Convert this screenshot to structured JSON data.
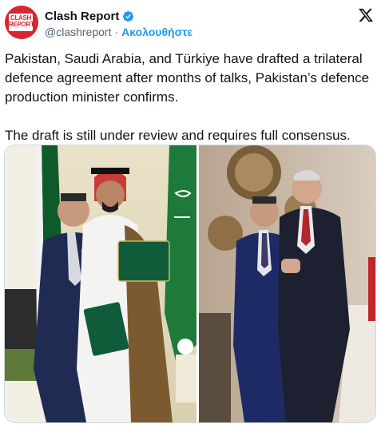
{
  "author": {
    "name": "Clash Report",
    "handle": "@clashreport",
    "separator": "·",
    "follow_label": "Ακολουθήστε",
    "avatar_text_line1": "CLASH",
    "avatar_text_line2": "REPORT"
  },
  "tweet": {
    "text": "Pakistan, Saudi Arabia, and Türkiye have drafted a trilateral defence agreement after months of talks, Pakistan’s defence production minister confirms.\n\nThe draft is still under review and requires full consensus."
  },
  "colors": {
    "accent": "#1d9bf0",
    "brand": "#d7262f",
    "text": "#0f1419",
    "secondary": "#536471"
  },
  "icons": {
    "verified": "verified-badge-icon",
    "platform": "x-logo-icon"
  }
}
